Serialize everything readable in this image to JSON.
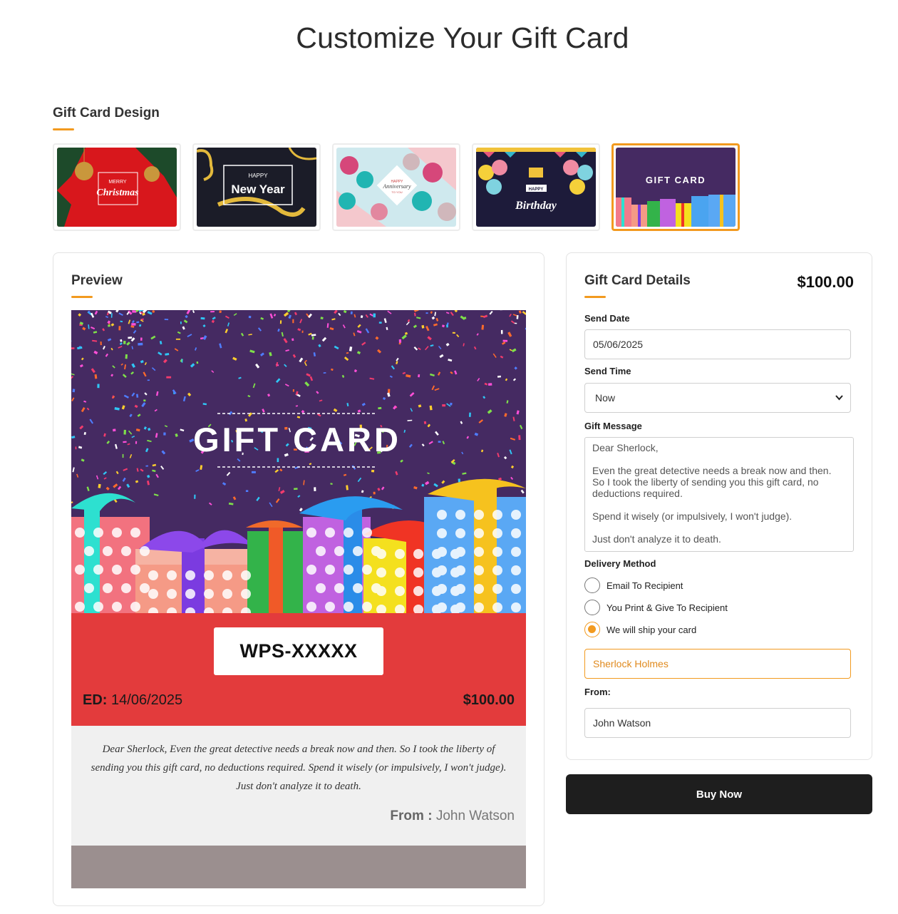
{
  "page": {
    "title": "Customize Your Gift Card"
  },
  "design_section": {
    "heading": "Gift Card Design",
    "designs": [
      {
        "id": "christmas",
        "line1": "MERRY",
        "line2": "Christmas",
        "selected": false
      },
      {
        "id": "new-year",
        "line1": "HAPPY",
        "line2": "New Year",
        "selected": false
      },
      {
        "id": "anniversary",
        "line1": "HAPPY",
        "line2": "Anniversary",
        "line3": "TO YOU",
        "selected": false
      },
      {
        "id": "birthday",
        "line1": "HAPPY",
        "line2": "Birthday",
        "selected": false
      },
      {
        "id": "gift-card",
        "line1": "GIFT CARD",
        "selected": true
      }
    ]
  },
  "preview": {
    "heading": "Preview",
    "card_title": "GIFT CARD",
    "code": "WPS-XXXXX",
    "ed_label": "ED:",
    "ed_value": "14/06/2025",
    "amount": "$100.00",
    "message": "Dear Sherlock, Even the great detective needs a break now and then. So I took the liberty of sending you this gift card, no deductions required. Spend it wisely (or impulsively, I won't judge). Just don't analyze it to death.",
    "from_label": "From :",
    "from_value": "John Watson"
  },
  "details": {
    "heading": "Gift Card Details",
    "amount": "$100.00",
    "send_date_label": "Send Date",
    "send_date_value": "05/06/2025",
    "send_time_label": "Send Time",
    "send_time_value": "Now",
    "gift_message_label": "Gift Message",
    "gift_message_paragraphs": [
      "Dear Sherlock,",
      "Even the great detective needs a break now and then. So I took the liberty of sending you this gift card, no deductions required.",
      "Spend it wisely (or impulsively, I won't judge).",
      "Just don't analyze it to death."
    ],
    "delivery_method_label": "Delivery Method",
    "delivery_options": [
      {
        "label": "Email To Recipient",
        "selected": false
      },
      {
        "label": "You Print & Give To Recipient",
        "selected": false
      },
      {
        "label": "We will ship your card",
        "selected": true
      }
    ],
    "recipient_value": "Sherlock Holmes",
    "from_label": "From:",
    "from_value": "John Watson"
  },
  "buy_button": {
    "label": "Buy Now"
  },
  "colors": {
    "accent": "#f29a1f",
    "card_red": "#e33b3c",
    "card_purple": "#452a62",
    "button_dark": "#1e1e1e"
  }
}
